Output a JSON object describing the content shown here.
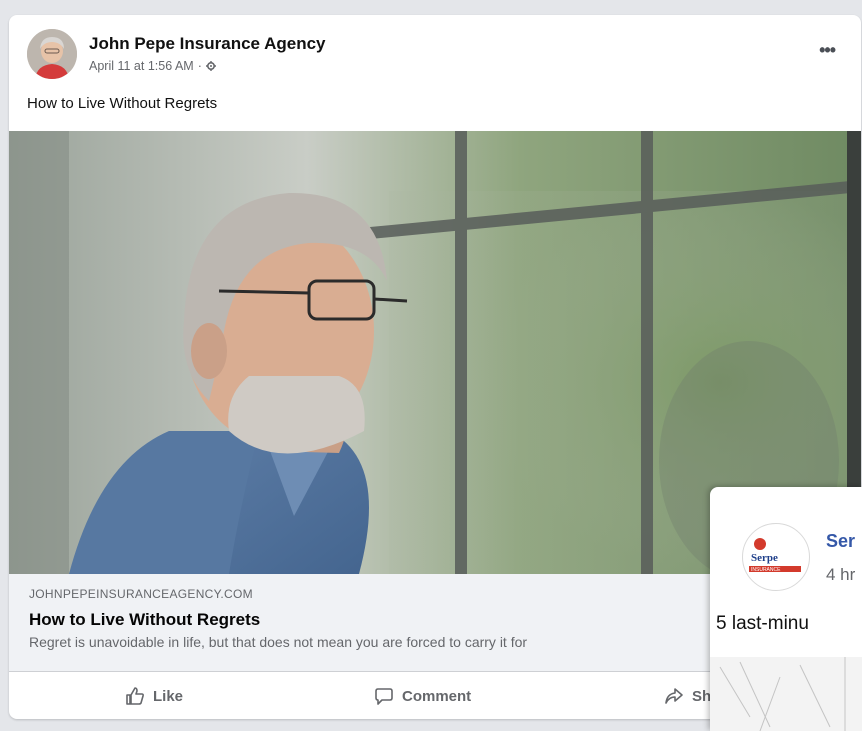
{
  "post": {
    "page_name": "John Pepe Insurance Agency",
    "timestamp": "April 11 at 1:56 AM",
    "separator": "·",
    "more_label": "•••",
    "text": "How to Live Without Regrets",
    "image_icon": "man-by-window-photo"
  },
  "link_preview": {
    "domain": "JOHNPEPEINSURANCEAGENCY.COM",
    "title": "How to Live Without Regrets",
    "description": "Regret is unavoidable in life, but that does not mean you are forced to carry it for"
  },
  "actions": {
    "like": "Like",
    "comment": "Comment",
    "share": "Sh"
  },
  "overlay": {
    "name": "Ser",
    "time": "4 hr",
    "text": "5 last-minu",
    "logo_text": "Serpe",
    "logo_subtext": "INSURANCE"
  },
  "colors": {
    "page_bg": "#e4e6ea",
    "card_bg": "#ffffff",
    "preview_bg": "#f0f2f5",
    "muted_text": "#65676b",
    "link_blue": "#3558a8"
  }
}
